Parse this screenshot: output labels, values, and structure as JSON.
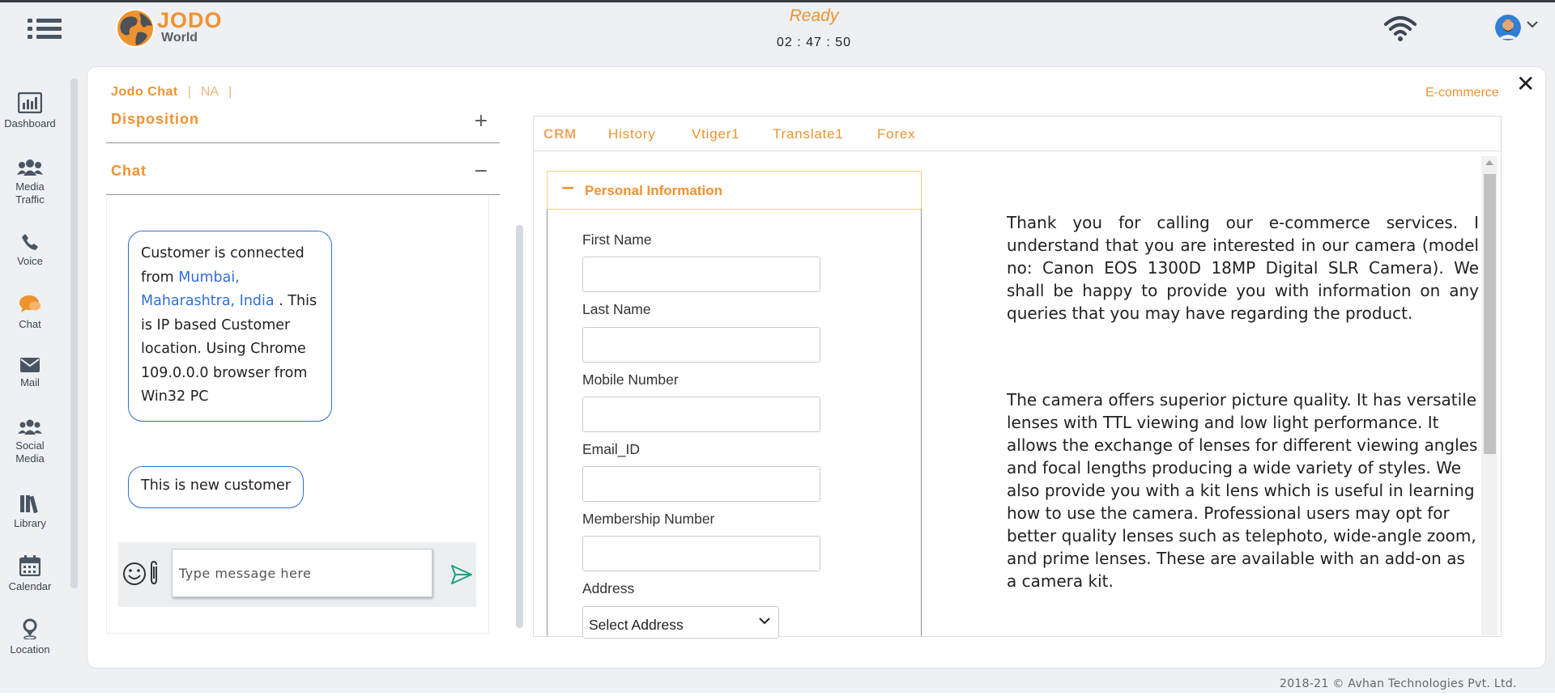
{
  "header": {
    "logo_primary": "JODO",
    "logo_secondary": "World",
    "status": "Ready",
    "timer": "02 : 47 : 50",
    "icons": {
      "menu": "hamburger-menu-icon",
      "wifi": "wifi-icon",
      "avatar": "user-avatar",
      "caret": "chevron-down-icon"
    }
  },
  "sidebar": {
    "items": [
      {
        "label": "Dashboard",
        "icon": "dashboard-icon"
      },
      {
        "label": "Media Traffic",
        "icon": "users-group-icon"
      },
      {
        "label": "Voice",
        "icon": "phone-icon"
      },
      {
        "label": "Chat",
        "icon": "chat-bubbles-icon"
      },
      {
        "label": "Mail",
        "icon": "envelope-icon"
      },
      {
        "label": "Social Media",
        "icon": "social-users-icon"
      },
      {
        "label": "Library",
        "icon": "books-icon"
      },
      {
        "label": "Calendar",
        "icon": "calendar-icon"
      },
      {
        "label": "Location",
        "icon": "location-pin-icon"
      }
    ],
    "active": "Chat"
  },
  "panel": {
    "tab_primary": "Jodo Chat",
    "separator": "|",
    "tab_secondary": "NA",
    "category": "E-commerce",
    "close_symbol": "✕"
  },
  "left": {
    "disposition": {
      "title": "Disposition",
      "symbol": "+"
    },
    "chat": {
      "title": "Chat",
      "symbol": "−"
    },
    "messages": [
      {
        "before": "Customer is connected from ",
        "location": "Mumbai, Maharashtra, India",
        "after": " . This is IP based Customer location. Using Chrome 109.0.0.0 browser from Win32 PC"
      },
      {
        "text": "This is new customer"
      }
    ],
    "composer": {
      "placeholder": "Type message here",
      "value": ""
    }
  },
  "crm": {
    "tabs": [
      "CRM",
      "History",
      "Vtiger1",
      "Translate1",
      "Forex"
    ],
    "active_tab": "CRM",
    "section": {
      "title": "Personal Information",
      "symbol": "−"
    },
    "fields": {
      "first_name": {
        "label": "First Name",
        "value": ""
      },
      "last_name": {
        "label": "Last Name",
        "value": ""
      },
      "mobile": {
        "label": "Mobile Number",
        "value": ""
      },
      "email": {
        "label": "Email_ID",
        "value": ""
      },
      "membership": {
        "label": "Membership Number",
        "value": ""
      },
      "address": {
        "label": "Address",
        "selected": "Select Address"
      }
    }
  },
  "script": {
    "p1": "Thank you for calling our e-commerce services. I understand that you are interested in our camera (model no: Canon EOS 1300D 18MP Digital SLR Camera). We shall be happy to provide you with information on any queries that you may have regarding the product.",
    "p2": "The camera offers superior picture quality. It has versatile lenses with TTL viewing and low light performance. It allows the exchange of lenses for different viewing angles and focal lengths producing a wide variety of styles. We also provide you with a kit lens which is useful in learning how to use the camera. Professional users may opt for better quality lenses such as telephoto, wide-angle zoom, and prime lenses. These are available with an add-on as a camera kit."
  },
  "footer": {
    "copyright": "2018-21 © Avhan Technologies Pvt. Ltd."
  },
  "colors": {
    "accent": "#f0922f",
    "link": "#2f6fd8",
    "nav_icon": "#4a5563",
    "send": "#1aa37a"
  }
}
